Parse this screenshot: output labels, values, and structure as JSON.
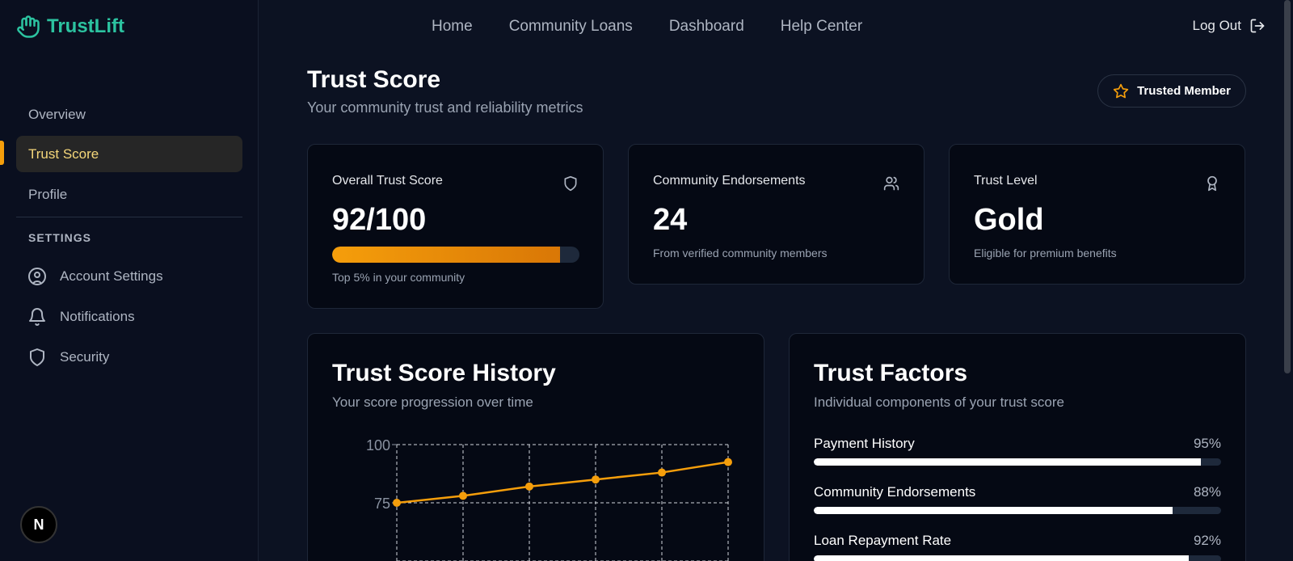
{
  "brand": {
    "name": "TrustLift",
    "color": "#2cc3a0"
  },
  "sidebar": {
    "items": [
      {
        "label": "Overview"
      },
      {
        "label": "Trust Score",
        "active": true
      },
      {
        "label": "Profile"
      }
    ],
    "settings_title": "SETTINGS",
    "settings": [
      {
        "label": "Account Settings",
        "icon": "user-circle-icon"
      },
      {
        "label": "Notifications",
        "icon": "bell-icon"
      },
      {
        "label": "Security",
        "icon": "shield-icon"
      }
    ],
    "badge_letter": "N"
  },
  "topnav": {
    "links": [
      "Home",
      "Community Loans",
      "Dashboard",
      "Help Center"
    ],
    "logout_label": "Log Out"
  },
  "header": {
    "title": "Trust Score",
    "subtitle": "Your community trust and reliability metrics",
    "badge_label": "Trusted Member"
  },
  "cards": {
    "overall": {
      "label": "Overall Trust Score",
      "value": "92/100",
      "progress": 0.92,
      "note": "Top 5% in your community"
    },
    "endorsements": {
      "label": "Community Endorsements",
      "value": "24",
      "note": "From verified community members"
    },
    "level": {
      "label": "Trust Level",
      "value": "Gold",
      "note": "Eligible for premium benefits"
    }
  },
  "history": {
    "title": "Trust Score History",
    "subtitle": "Your score progression over time"
  },
  "factors": {
    "title": "Trust Factors",
    "subtitle": "Individual components of your trust score",
    "items": [
      {
        "label": "Payment History",
        "pct": "95%",
        "value": 0.95
      },
      {
        "label": "Community Endorsements",
        "pct": "88%",
        "value": 0.88
      },
      {
        "label": "Loan Repayment Rate",
        "pct": "92%",
        "value": 0.92
      }
    ]
  },
  "colors": {
    "accent": "#f59e0b",
    "background": "#0c1222",
    "card": "#050914"
  },
  "chart_data": {
    "type": "line",
    "title": "",
    "xlabel": "",
    "ylabel": "",
    "y_tick_labels": [
      "100",
      "75"
    ],
    "ylim": [
      50,
      100
    ],
    "grid": true,
    "series": [
      {
        "values": [
          75,
          78,
          82,
          85,
          88,
          92.5
        ]
      }
    ]
  }
}
